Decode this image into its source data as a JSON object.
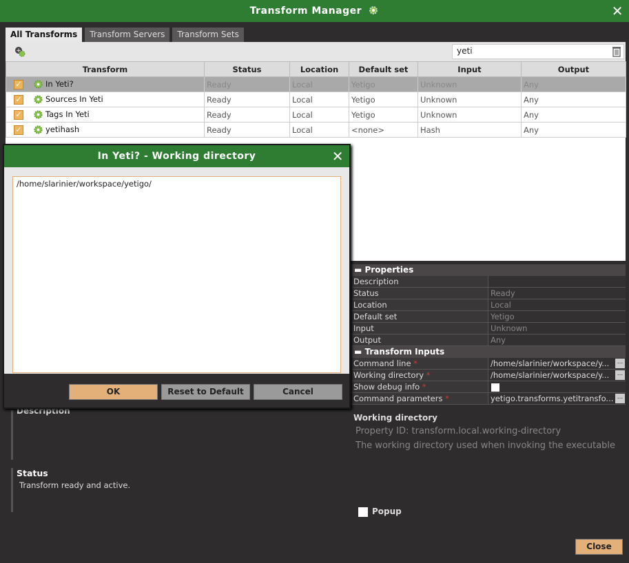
{
  "window": {
    "title": "Transform Manager",
    "close": "✕"
  },
  "tabs": [
    "All Transforms",
    "Transform Servers",
    "Transform Sets"
  ],
  "search": {
    "value": "yeti",
    "placeholder": ""
  },
  "table": {
    "headers": [
      "Transform",
      "Status",
      "Location",
      "Default set",
      "Input",
      "Output"
    ],
    "rows": [
      {
        "name": "In Yeti?",
        "status": "Ready",
        "location": "Local",
        "set": "Yetigo",
        "input": "Unknown",
        "output": "Any",
        "checked": true,
        "selected": true
      },
      {
        "name": "Sources In Yeti",
        "status": "Ready",
        "location": "Local",
        "set": "Yetigo",
        "input": "Unknown",
        "output": "Any",
        "checked": true,
        "selected": false
      },
      {
        "name": "Tags In Yeti",
        "status": "Ready",
        "location": "Local",
        "set": "Yetigo",
        "input": "Unknown",
        "output": "Any",
        "checked": true,
        "selected": false
      },
      {
        "name": "yetihash",
        "status": "Ready",
        "location": "Local",
        "set": "<none>",
        "input": "Hash",
        "output": "Any",
        "checked": true,
        "selected": false
      }
    ]
  },
  "properties": {
    "section1": "Properties",
    "rows1": [
      {
        "k": "Description",
        "v": ""
      },
      {
        "k": "Status",
        "v": "Ready"
      },
      {
        "k": "Location",
        "v": "Local"
      },
      {
        "k": "Default set",
        "v": "Yetigo"
      },
      {
        "k": "Input",
        "v": "Unknown"
      },
      {
        "k": "Output",
        "v": "Any"
      }
    ],
    "section2": "Transform Inputs",
    "rows2": [
      {
        "k": "Command line",
        "v": "/home/slarinier/workspace/y...",
        "req": true,
        "btn": "..."
      },
      {
        "k": "Working directory",
        "v": "/home/slarinier/workspace/y...",
        "req": true,
        "btn": "..."
      },
      {
        "k": "Show debug info",
        "v": "",
        "req": true,
        "box": true
      },
      {
        "k": "Command parameters",
        "v": "yetigo.transforms.yetitransfo...",
        "req": true,
        "btn": "..."
      }
    ]
  },
  "help": {
    "title": "Working directory",
    "property_id": "Property ID: transform.local.working-directory",
    "description": "The working directory used when invoking the executable"
  },
  "popup_label": "Popup",
  "left_panel": {
    "description_label": "Description",
    "status_label": "Status",
    "status_value": "Transform ready and active."
  },
  "footer": {
    "close_label": "Close"
  },
  "dialog": {
    "title": "In Yeti? - Working directory",
    "close": "✕",
    "value": "/home/slarinier/workspace/yetigo/",
    "ok_label": "OK",
    "reset_label": "Reset to Default",
    "cancel_label": "Cancel"
  },
  "colors": {
    "accent": "#2e7d32",
    "button": "#e3b07a",
    "checkbox": "#f0b45a"
  }
}
